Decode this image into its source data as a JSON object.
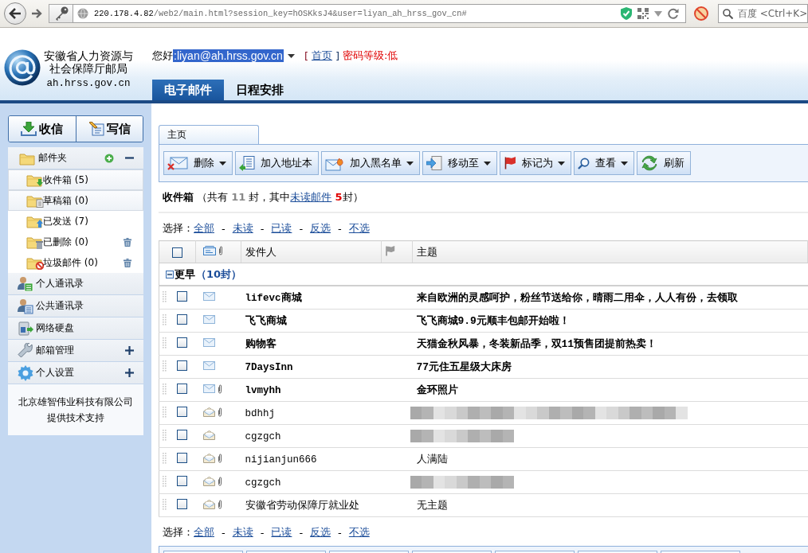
{
  "browser": {
    "url_host": "220.178.4.82",
    "url_path": "/web2/main.html?session_key=hOSKksJ4&user=liyan_ah_hrss_gov_cn#",
    "search": {
      "placeholder": "百度 <Ctrl+K>"
    }
  },
  "header": {
    "org_name_lines": [
      "安徽省人力资源与",
      "社会保障厅邮局"
    ],
    "domain": "ah.hrss.gov.cn",
    "greeting": "您好",
    "account": ":liyan@ah.hrss.gov.cn",
    "account_highlighted": true,
    "bracket_open": "[",
    "home_link": "首页",
    "bracket_close": "]",
    "password_strength": "密码等级:低"
  },
  "nav_tabs": [
    {
      "label": "电子邮件",
      "selected": true
    },
    {
      "label": "日程安排",
      "selected": false
    }
  ],
  "sidebar": {
    "buttons": [
      "收信",
      "写信"
    ],
    "folder_panel": {
      "label": "邮件夹",
      "expanded": true,
      "folders": [
        {
          "label": "收件箱 (5)",
          "selected": true,
          "trash": false
        },
        {
          "label": "草稿箱 (0)",
          "selected": true,
          "trash": false
        },
        {
          "label": "已发送 (7)",
          "selected": false,
          "trash": false
        },
        {
          "label": "已删除 (0)",
          "selected": false,
          "trash": true
        },
        {
          "label": "垃圾邮件 (0)",
          "selected": false,
          "trash": true
        }
      ]
    },
    "sections": [
      {
        "label": "个人通讯录",
        "kind": "link"
      },
      {
        "label": "公共通讯录",
        "kind": "link"
      },
      {
        "label": "网络硬盘",
        "kind": "link"
      },
      {
        "label": "邮箱管理",
        "kind": "menu",
        "expanded": false
      },
      {
        "label": "个人设置",
        "kind": "menu",
        "expanded": false
      }
    ],
    "footer_lines": [
      "北京雄智伟业科技有限公司",
      "提供技术支持"
    ]
  },
  "main": {
    "tabs": [
      {
        "label": "主页",
        "selected": true
      }
    ],
    "toolbar": [
      {
        "label": "删除",
        "dropdown": true
      },
      {
        "label": "加入地址本",
        "dropdown": false
      },
      {
        "label": "加入黑名单",
        "dropdown": true
      },
      {
        "label": "移动至",
        "dropdown": true
      },
      {
        "label": "标记为",
        "dropdown": true
      },
      {
        "label": "查看",
        "dropdown": true
      },
      {
        "label": "刷新",
        "dropdown": false
      }
    ],
    "summary": {
      "folder": "收件箱",
      "prefix": "（共有",
      "total": "11",
      "middle": "封，其中",
      "link": "未读邮件",
      "unread": "5",
      "suffix": "封）"
    },
    "select_top": {
      "label": "选择：",
      "items": [
        {
          "kind": "link",
          "text": "全部"
        },
        {
          "kind": "dash",
          "text": "-"
        },
        {
          "kind": "link",
          "text": "未读"
        },
        {
          "kind": "dash",
          "text": "-"
        },
        {
          "kind": "link",
          "text": "已读"
        },
        {
          "kind": "dash",
          "text": "-"
        },
        {
          "kind": "link",
          "text": "反选"
        },
        {
          "kind": "dash",
          "text": "-"
        },
        {
          "kind": "link",
          "text": "不选"
        }
      ]
    },
    "table": {
      "select_all_checked": false,
      "columns": {
        "sender": "发件人",
        "subject": "主题"
      },
      "group": {
        "label": "更早",
        "count": "（10封）",
        "expanded": true
      },
      "rows": [
        {
          "kind": "text",
          "sender": "lifevc商城",
          "subject": "来自欧洲的灵感呵护，粉丝节送给你，晴雨二用伞，人人有份，去领取",
          "unread": true,
          "attachment": false,
          "checked": false
        },
        {
          "kind": "text",
          "sender": "飞飞商城",
          "subject": "飞飞商城9.9元顺丰包邮开始啦！",
          "unread": true,
          "attachment": false,
          "checked": false
        },
        {
          "kind": "text",
          "sender": "购物客",
          "subject": "天猫金秋风暴，冬装新品季，双11预售团提前热卖！",
          "unread": true,
          "attachment": false,
          "checked": false
        },
        {
          "kind": "text",
          "sender": "7DaysInn",
          "subject": "77元住五星级大床房",
          "unread": true,
          "attachment": false,
          "checked": false
        },
        {
          "kind": "text",
          "sender": "lvmyhh",
          "subject": "金环照片",
          "unread": true,
          "attachment": true,
          "checked": false
        },
        {
          "kind": "widemosaic",
          "sender": "bdhhj",
          "unread": false,
          "attachment": true,
          "checked": false
        },
        {
          "kind": "mosaic",
          "sender": "cgzgch",
          "unread": false,
          "attachment": false,
          "checked": false
        },
        {
          "kind": "text",
          "sender": "nijianjun666",
          "subject": "人满陆",
          "unread": false,
          "attachment": true,
          "checked": false
        },
        {
          "kind": "mosaic",
          "sender": "cgzgch",
          "unread": false,
          "attachment": true,
          "checked": false
        },
        {
          "kind": "text",
          "sender": "安徽省劳动保障厅就业处",
          "subject": "无主题",
          "unread": false,
          "attachment": true,
          "checked": false
        }
      ]
    },
    "select_bottom": {
      "label": "选择：",
      "items": [
        {
          "kind": "link",
          "text": "全部"
        },
        {
          "kind": "dash",
          "text": "-"
        },
        {
          "kind": "link",
          "text": "未读"
        },
        {
          "kind": "dash",
          "text": "-"
        },
        {
          "kind": "link",
          "text": "已读"
        },
        {
          "kind": "dash",
          "text": "-"
        },
        {
          "kind": "link",
          "text": "反选"
        },
        {
          "kind": "dash",
          "text": "-"
        },
        {
          "kind": "link",
          "text": "不选"
        }
      ]
    }
  }
}
